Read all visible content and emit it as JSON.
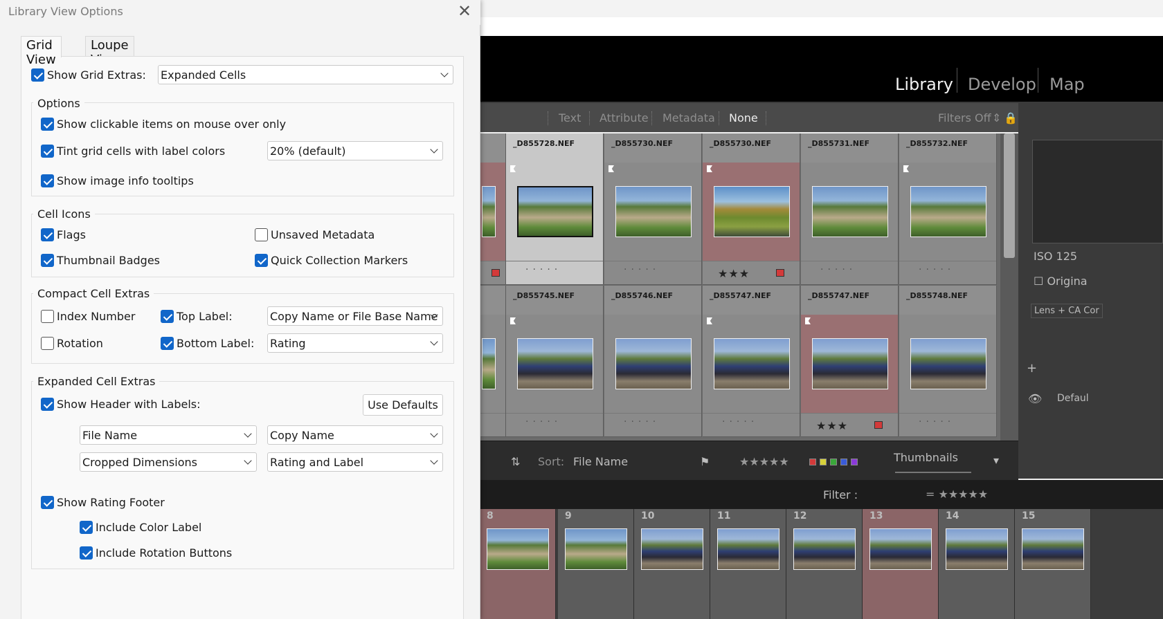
{
  "dialog": {
    "title": "Library View Options",
    "tabs": [
      {
        "label": "Grid View"
      },
      {
        "label": "Loupe View"
      }
    ],
    "show_grid_extras": {
      "label": "Show Grid Extras:",
      "checked": true,
      "value": "Expanded Cells"
    },
    "options": {
      "title": "Options",
      "clickable": {
        "label": "Show clickable items on mouse over only",
        "checked": true
      },
      "tint": {
        "label": "Tint grid cells with label colors",
        "checked": true,
        "value": "20% (default)"
      },
      "tooltips": {
        "label": "Show image info tooltips",
        "checked": true
      }
    },
    "cell_icons": {
      "title": "Cell Icons",
      "flags": {
        "label": "Flags",
        "checked": true
      },
      "unsaved": {
        "label": "Unsaved Metadata",
        "checked": false
      },
      "badges": {
        "label": "Thumbnail Badges",
        "checked": true
      },
      "quick": {
        "label": "Quick Collection Markers",
        "checked": true
      }
    },
    "compact": {
      "title": "Compact Cell Extras",
      "index": {
        "label": "Index Number",
        "checked": false
      },
      "top": {
        "label": "Top Label:",
        "checked": true,
        "value": "Copy Name or File Base Name"
      },
      "rotation": {
        "label": "Rotation",
        "checked": false
      },
      "bottom": {
        "label": "Bottom Label:",
        "checked": true,
        "value": "Rating"
      }
    },
    "expanded": {
      "title": "Expanded Cell Extras",
      "header": {
        "label": "Show Header with Labels:",
        "checked": true
      },
      "use_defaults": "Use Defaults",
      "sel1": "File Name",
      "sel2": "Copy Name",
      "sel3": "Cropped Dimensions",
      "sel4": "Rating and Label",
      "footer": {
        "label": "Show Rating Footer",
        "checked": true
      },
      "color": {
        "label": "Include Color Label",
        "checked": true
      },
      "rotbtn": {
        "label": "Include Rotation Buttons",
        "checked": true
      }
    }
  },
  "lightroom": {
    "modules": [
      "Library",
      "Develop",
      "Map"
    ],
    "filters": [
      "Text",
      "Attribute",
      "Metadata",
      "None"
    ],
    "filters_off": "Filters Off",
    "grid_row1": [
      "_D855728.NEF",
      "_D855730.NEF",
      "_D855730.NEF",
      "_D855731.NEF",
      "_D855732.NEF"
    ],
    "grid_row2": [
      "_D855745.NEF",
      "_D855746.NEF",
      "_D855747.NEF",
      "_D855747.NEF",
      "_D855748.NEF"
    ],
    "iso": "ISO 125",
    "original": "Origina",
    "lens": "Lens + CA Cor",
    "default": "Defaul",
    "sort_label": "Sort:",
    "sort_value": "File Name",
    "thumbnails": "Thumbnails",
    "filter_label": "Filter :",
    "film_numbers": [
      "8",
      "9",
      "10",
      "11",
      "12",
      "13",
      "14",
      "15"
    ],
    "stars3": "★★★",
    "colors": {
      "red": "#d33a3a",
      "yellow": "#d8d23a",
      "green": "#3aa83a",
      "blue": "#3a5bd8",
      "purple": "#8a3ad8"
    }
  }
}
